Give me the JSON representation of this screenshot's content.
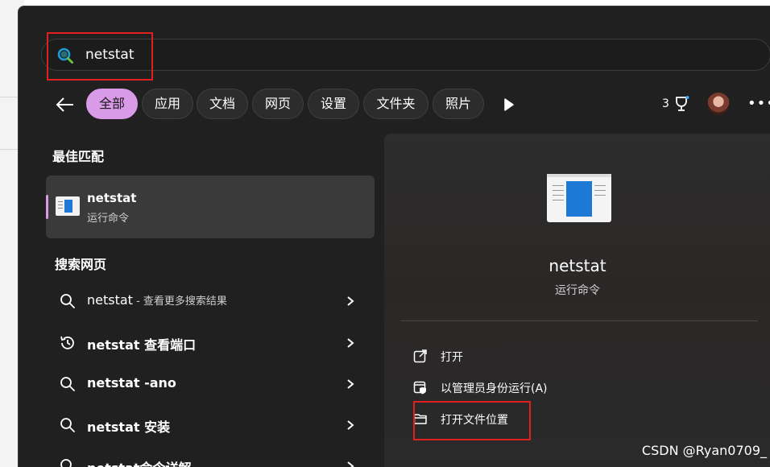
{
  "search": {
    "query": "netstat"
  },
  "filters": {
    "tabs": [
      {
        "label": "全部",
        "active": true
      },
      {
        "label": "应用"
      },
      {
        "label": "文档"
      },
      {
        "label": "网页"
      },
      {
        "label": "设置"
      },
      {
        "label": "文件夹"
      },
      {
        "label": "照片"
      }
    ],
    "points": "3"
  },
  "results": {
    "best_match_title": "最佳匹配",
    "best_match": {
      "name": "netstat",
      "type": "运行命令"
    },
    "web_title": "搜索网页",
    "web_items": [
      {
        "query": "netstat",
        "suffix": " - 查看更多搜索结果",
        "icon": "search-icon"
      },
      {
        "query": "netstat 查看端口",
        "suffix": "",
        "icon": "history-icon"
      },
      {
        "query": "netstat -ano",
        "suffix": "",
        "icon": "search-icon"
      },
      {
        "query": "netstat 安装",
        "suffix": "",
        "icon": "search-icon"
      },
      {
        "query": "netstat命令详解",
        "suffix": "",
        "icon": "search-icon"
      }
    ]
  },
  "detail": {
    "name": "netstat",
    "type": "运行命令",
    "actions": [
      {
        "label": "打开",
        "icon": "open-icon"
      },
      {
        "label": "以管理员身份运行(A)",
        "icon": "admin-icon"
      },
      {
        "label": "打开文件位置",
        "icon": "folder-icon"
      }
    ]
  },
  "watermark": "CSDN @Ryan0709_",
  "colors": {
    "accent": "#d99ae8",
    "highlight_box": "#e0201e",
    "panel": "#202020"
  }
}
